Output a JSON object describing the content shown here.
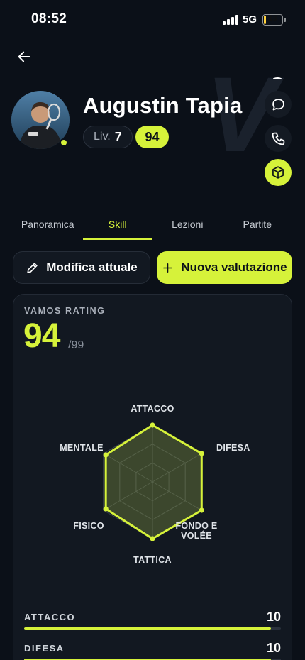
{
  "status_bar": {
    "time": "08:52",
    "network": "5G",
    "battery": "13",
    "battery_level": 0.13
  },
  "profile": {
    "name": "Augustin Tapia",
    "level_label": "Liv.",
    "level_value": "7",
    "score": "94",
    "online": true
  },
  "tabs": [
    {
      "label": "Panoramica",
      "active": false
    },
    {
      "label": "Skill",
      "active": true
    },
    {
      "label": "Lezioni",
      "active": false
    },
    {
      "label": "Partite",
      "active": false
    }
  ],
  "actions": {
    "edit_label": "Modifica attuale",
    "new_label": "Nuova valutazione"
  },
  "rating": {
    "label": "VAMOS RATING",
    "value": "94",
    "max": "/99"
  },
  "radar": {
    "axes": [
      "ATTACCO",
      "DIFESA",
      "FONDO E VOLÉE",
      "TATTICA",
      "FISICO",
      "MENTALE"
    ],
    "values": [
      10,
      10,
      10,
      10,
      9.5,
      9.5
    ],
    "max": 10
  },
  "skills": [
    {
      "label": "ATTACCO",
      "value": "10",
      "fill": 0.96
    },
    {
      "label": "DIFESA",
      "value": "10",
      "fill": 0.96
    }
  ],
  "colors": {
    "accent": "#d6f23a",
    "background": "#0b1018",
    "card": "#121821"
  },
  "icons": [
    "arrow-left-icon",
    "chat-bubble-icon",
    "phone-icon",
    "cube-icon",
    "pencil-icon",
    "plus-icon"
  ]
}
